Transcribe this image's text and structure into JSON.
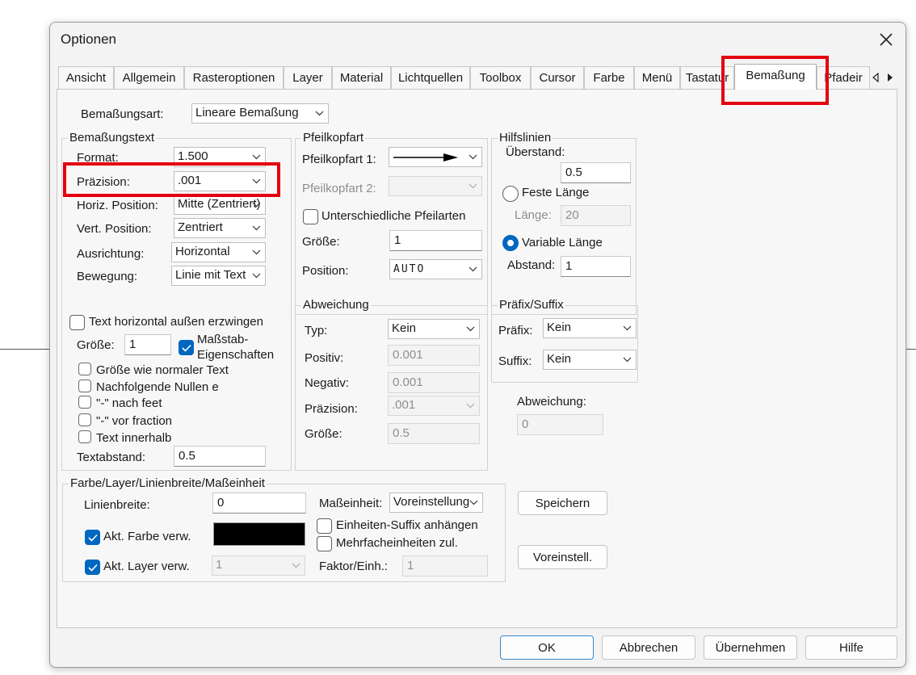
{
  "colors": {
    "accent": "#0067c0",
    "annotation": "#e3000f",
    "color_swatch": "#000000"
  },
  "dialog": {
    "title": "Optionen",
    "close_icon": "close-icon"
  },
  "tabs": [
    {
      "label": "Ansicht",
      "active": false
    },
    {
      "label": "Allgemein",
      "active": false
    },
    {
      "label": "Rasteroptionen",
      "active": false
    },
    {
      "label": "Layer",
      "active": false
    },
    {
      "label": "Material",
      "active": false
    },
    {
      "label": "Lichtquellen",
      "active": false
    },
    {
      "label": "Toolbox",
      "active": false
    },
    {
      "label": "Cursor",
      "active": false
    },
    {
      "label": "Farbe",
      "active": false
    },
    {
      "label": "Menü",
      "active": false
    },
    {
      "label": "Tastatur",
      "active": false
    },
    {
      "label": "Bemaßung",
      "active": true
    },
    {
      "label": "Pfadeir",
      "active": false
    }
  ],
  "bemassungsart": {
    "label": "Bemaßungsart:",
    "value": "Lineare Bemaßung"
  },
  "bemassungstext": {
    "title": "Bemaßungstext",
    "format": {
      "label": "Format:",
      "value": "1.500"
    },
    "praezision": {
      "label": "Präzision:",
      "value": ".001"
    },
    "horiz": {
      "label": "Horiz. Position:",
      "value": "Mitte (Zentriert)"
    },
    "vert": {
      "label": "Vert. Position:",
      "value": "Zentriert"
    },
    "ausrichtung": {
      "label": "Ausrichtung:",
      "value": "Horizontal"
    },
    "bewegung": {
      "label": "Bewegung:",
      "value": "Linie mit Text"
    },
    "text_horizontal": {
      "label": "Text horizontal außen erzwingen",
      "checked": false
    },
    "groesse": {
      "label": "Größe:",
      "value": "1"
    },
    "massstab_line1": "Maßstab-",
    "massstab_line2": "Eigenschaften",
    "massstab_checked": true,
    "groesse_normal": "Größe wie normaler Text",
    "nachfolgende_nullen": "Nachfolgende Nullen e",
    "nach_feet": "\"-\" nach feet",
    "vor_fraction": "\"-\" vor fraction",
    "text_innerhalb": "Text innerhalb",
    "textabstand": {
      "label": "Textabstand:",
      "value": "0.5"
    }
  },
  "pfeilkopfart": {
    "title": "Pfeilkopfart",
    "pfeilkopf1_label": "Pfeilkopfart 1:",
    "pfeilkopf2_label": "Pfeilkopfart 2:",
    "unterschiedliche": "Unterschiedliche Pfeilarten",
    "groesse": {
      "label": "Größe:",
      "value": "1"
    },
    "position": {
      "label": "Position:",
      "value": "AUTO"
    }
  },
  "hilfslinien": {
    "title": "Hilfslinien",
    "ueberstand_label": "Überstand:",
    "ueberstand_value": "0.5",
    "feste_laenge": "Feste Länge",
    "laenge": {
      "label": "Länge:",
      "value": "20"
    },
    "variable_laenge": "Variable Länge",
    "abstand": {
      "label": "Abstand:",
      "value": "1"
    }
  },
  "abweichung_group": {
    "title": "Abweichung",
    "typ": {
      "label": "Typ:",
      "value": "Kein"
    },
    "positiv": {
      "label": "Positiv:",
      "value": "0.001"
    },
    "negativ": {
      "label": "Negativ:",
      "value": "0.001"
    },
    "praezision": {
      "label": "Präzision:",
      "value": ".001"
    },
    "groesse": {
      "label": "Größe:",
      "value": "0.5"
    }
  },
  "praefix_suffix": {
    "title": "Präfix/Suffix",
    "praefix": {
      "label": "Präfix:",
      "value": "Kein"
    },
    "suffix": {
      "label": "Suffix:",
      "value": "Kein"
    }
  },
  "abweichung_field": {
    "label": "Abweichung:",
    "value": "0"
  },
  "farbe_layer": {
    "title": "Farbe/Layer/Linienbreite/Maßeinheit",
    "linienbreite": {
      "label": "Linienbreite:",
      "value": "0"
    },
    "akt_farbe": "Akt. Farbe verw.",
    "akt_layer": "Akt. Layer verw.",
    "layer_value": "1",
    "masseinheit": {
      "label": "Maßeinheit:",
      "value": "Voreinstellung"
    },
    "einheiten_suffix": "Einheiten-Suffix anhängen",
    "mehrfacheinheiten": "Mehrfacheinheiten zul.",
    "faktor": {
      "label": "Faktor/Einh.:",
      "value": "1"
    }
  },
  "side_buttons": {
    "speichern": "Speichern",
    "voreinstell": "Voreinstell."
  },
  "footer": {
    "ok": "OK",
    "abbrechen": "Abbrechen",
    "uebernehmen": "Übernehmen",
    "hilfe": "Hilfe"
  }
}
